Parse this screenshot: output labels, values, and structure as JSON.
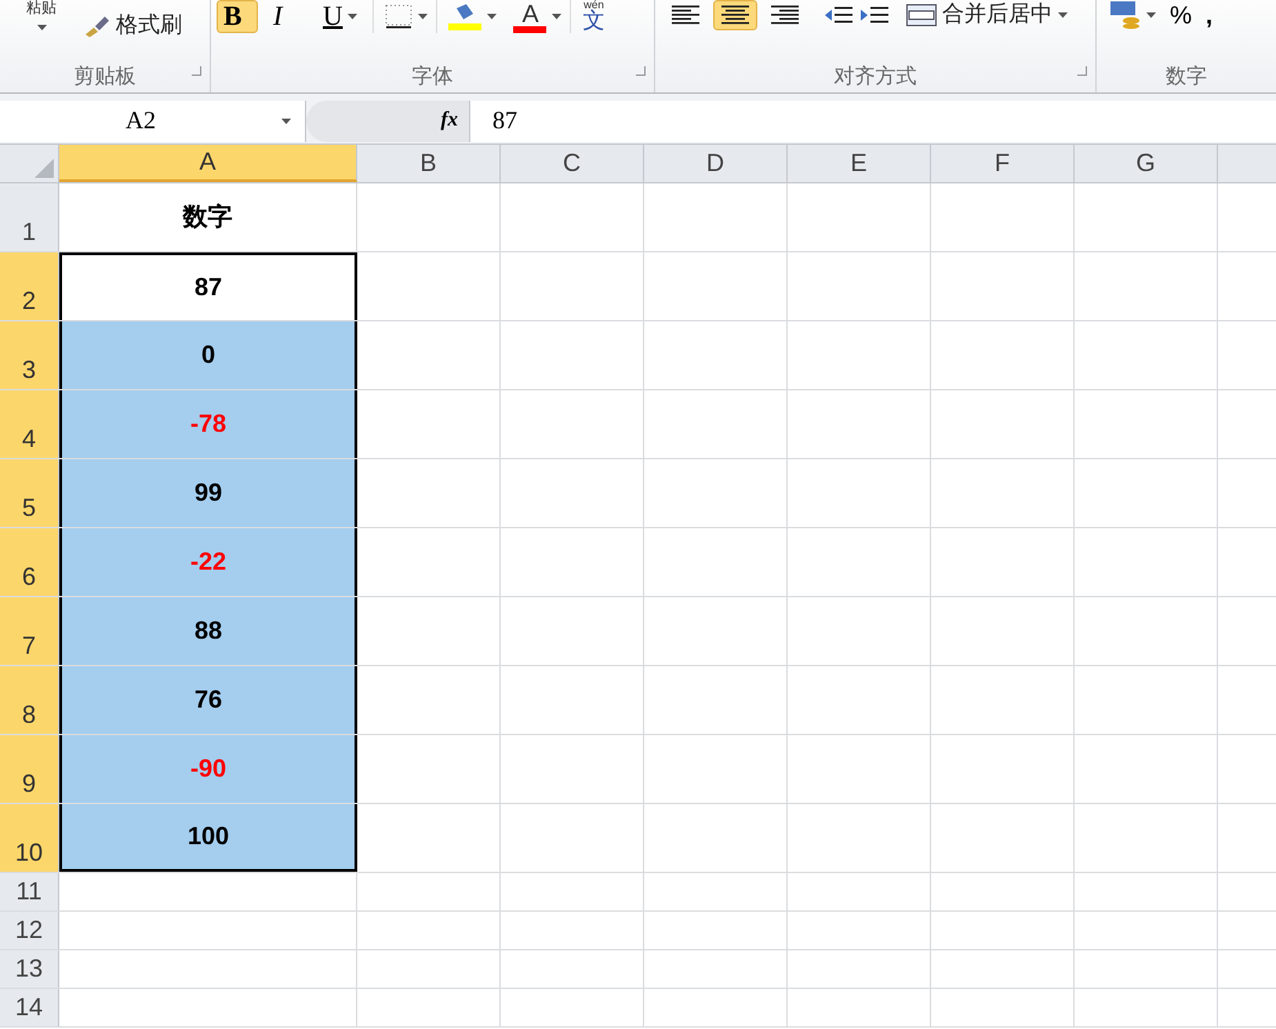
{
  "ribbon": {
    "clipboard": {
      "paste_label": "粘贴",
      "format_painter": "格式刷",
      "group_label": "剪贴板"
    },
    "font": {
      "buttons": [
        {
          "kind": "bold",
          "label": "B",
          "selected": true
        },
        {
          "kind": "italic",
          "label": "I",
          "selected": false
        },
        {
          "kind": "underline",
          "label": "U",
          "selected": false
        }
      ],
      "font_color_label": "A",
      "phonetic_top": "wén",
      "phonetic_label": "文",
      "group_label": "字体"
    },
    "alignment": {
      "buttons": [
        {
          "kind": "left",
          "selected": false
        },
        {
          "kind": "center",
          "selected": true
        },
        {
          "kind": "right",
          "selected": false
        }
      ],
      "merge_label": "合并后居中",
      "group_label": "对齐方式"
    },
    "number": {
      "percent": "%",
      "comma": ",",
      "group_label": "数字"
    }
  },
  "formula_bar": {
    "name_box": "A2",
    "fx": "fx",
    "value": "87"
  },
  "columns": [
    {
      "label": "A",
      "selected": true
    },
    {
      "label": "B",
      "selected": false
    },
    {
      "label": "C",
      "selected": false
    },
    {
      "label": "D",
      "selected": false
    },
    {
      "label": "E",
      "selected": false
    },
    {
      "label": "F",
      "selected": false
    },
    {
      "label": "G",
      "selected": false
    }
  ],
  "rows": [
    {
      "label": "1",
      "selected": false,
      "value": "数字",
      "kind": "header"
    },
    {
      "label": "2",
      "selected": true,
      "value": "87",
      "kind": "active",
      "color": "#000000"
    },
    {
      "label": "3",
      "selected": true,
      "value": "0",
      "kind": "value",
      "color": "#000000"
    },
    {
      "label": "4",
      "selected": true,
      "value": "-78",
      "kind": "value",
      "color": "#ff0000"
    },
    {
      "label": "5",
      "selected": true,
      "value": "99",
      "kind": "value",
      "color": "#000000"
    },
    {
      "label": "6",
      "selected": true,
      "value": "-22",
      "kind": "value",
      "color": "#ff0000"
    },
    {
      "label": "7",
      "selected": true,
      "value": "88",
      "kind": "value",
      "color": "#000000"
    },
    {
      "label": "8",
      "selected": true,
      "value": "76",
      "kind": "value",
      "color": "#000000"
    },
    {
      "label": "9",
      "selected": true,
      "value": "-90",
      "kind": "value",
      "color": "#ff0000"
    },
    {
      "label": "10",
      "selected": true,
      "value": "100",
      "kind": "value",
      "color": "#000000"
    },
    {
      "label": "11",
      "selected": false,
      "kind": "empty"
    },
    {
      "label": "12",
      "selected": false,
      "kind": "empty"
    },
    {
      "label": "13",
      "selected": false,
      "kind": "empty"
    },
    {
      "label": "14",
      "selected": false,
      "kind": "empty"
    }
  ]
}
